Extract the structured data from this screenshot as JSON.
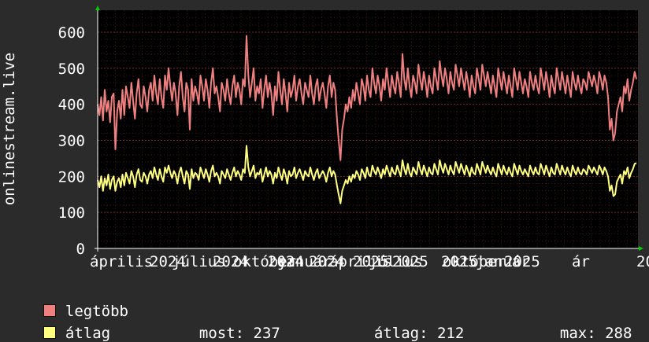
{
  "chart_data": {
    "type": "line",
    "ylabel": "onlinestream.live",
    "yticks": [
      "0",
      "100",
      "200",
      "300",
      "400",
      "500",
      "600"
    ],
    "ylim": [
      0,
      650
    ],
    "xtick_labels": [
      "április",
      "2024",
      "július",
      "2024",
      "október",
      "2024",
      "január",
      "2024",
      "április",
      "2025",
      "július",
      "2025",
      "október",
      "2025",
      "január",
      "2025",
      "ár",
      "20"
    ],
    "grid": true,
    "series": [
      {
        "name": "legtöbb",
        "color": "#f08080",
        "values": [
          400,
          370,
          420,
          355,
          440,
          380,
          410,
          350,
          420,
          430,
          275,
          380,
          410,
          360,
          440,
          370,
          450,
          420,
          390,
          460,
          410,
          360,
          430,
          470,
          400,
          390,
          450,
          420,
          380,
          440,
          460,
          410,
          480,
          430,
          400,
          470,
          420,
          390,
          480,
          440,
          500,
          450,
          410,
          460,
          430,
          370,
          450,
          490,
          420,
          380,
          460,
          440,
          330,
          470,
          410,
          450,
          430,
          400,
          480,
          450,
          410,
          470,
          440,
          390,
          460,
          500,
          430,
          450,
          420,
          380,
          460,
          440,
          410,
          470,
          430,
          400,
          450,
          480,
          420,
          460,
          440,
          400,
          470,
          450,
          590,
          480,
          420,
          460,
          500,
          410,
          450,
          430,
          470,
          390,
          440,
          480,
          420,
          460,
          430,
          370,
          450,
          410,
          490,
          440,
          400,
          470,
          430,
          380,
          460,
          420,
          440,
          480,
          410,
          450,
          470,
          430,
          400,
          460,
          440,
          420,
          480,
          430,
          400,
          450,
          470,
          410,
          440,
          460,
          430,
          390,
          450,
          480,
          420,
          460,
          440,
          360,
          300,
          245,
          330,
          360,
          400,
          380,
          420,
          390,
          440,
          410,
          460,
          430,
          400,
          470,
          450,
          410,
          480,
          440,
          420,
          500,
          460,
          430,
          480,
          450,
          410,
          470,
          440,
          500,
          460,
          420,
          480,
          450,
          430,
          490,
          460,
          420,
          540,
          470,
          440,
          500,
          450,
          420,
          480,
          460,
          430,
          510,
          470,
          440,
          490,
          460,
          420,
          480,
          450,
          430,
          500,
          470,
          440,
          520,
          480,
          450,
          500,
          470,
          430,
          490,
          460,
          440,
          510,
          480,
          450,
          500,
          470,
          440,
          490,
          460,
          420,
          480,
          450,
          430,
          500,
          470,
          440,
          510,
          480,
          450,
          490,
          460,
          430,
          480,
          450,
          420,
          500,
          470,
          440,
          490,
          460,
          430,
          480,
          450,
          420,
          500,
          470,
          440,
          490,
          460,
          430,
          470,
          450,
          420,
          490,
          460,
          440,
          480,
          450,
          430,
          500,
          470,
          440,
          490,
          460,
          420,
          480,
          450,
          430,
          500,
          470,
          440,
          490,
          460,
          430,
          480,
          450,
          420,
          490,
          460,
          440,
          480,
          450,
          430,
          470,
          460,
          440,
          490,
          470,
          450,
          480,
          460,
          430,
          490,
          470,
          440,
          480,
          460,
          420,
          330,
          360,
          300,
          320,
          380,
          400,
          420,
          380,
          450,
          430,
          470,
          410,
          440,
          460,
          490,
          470
        ],
        "legend_text": ""
      },
      {
        "name": "átlag",
        "color": "#ffff80",
        "values": [
          190,
          170,
          200,
          160,
          195,
          175,
          205,
          165,
          190,
          200,
          160,
          185,
          195,
          170,
          205,
          175,
          210,
          195,
          180,
          215,
          200,
          170,
          205,
          220,
          190,
          185,
          210,
          200,
          180,
          205,
          215,
          195,
          225,
          205,
          190,
          220,
          200,
          185,
          225,
          210,
          230,
          210,
          195,
          215,
          205,
          180,
          210,
          225,
          200,
          180,
          215,
          205,
          165,
          220,
          195,
          210,
          205,
          190,
          225,
          210,
          195,
          220,
          205,
          185,
          215,
          230,
          200,
          210,
          200,
          180,
          215,
          205,
          195,
          220,
          205,
          190,
          210,
          225,
          200,
          215,
          205,
          190,
          220,
          210,
          285,
          225,
          200,
          215,
          230,
          195,
          210,
          205,
          220,
          185,
          205,
          225,
          200,
          215,
          205,
          180,
          210,
          195,
          225,
          205,
          190,
          220,
          205,
          180,
          215,
          200,
          205,
          225,
          195,
          210,
          220,
          205,
          190,
          215,
          205,
          200,
          225,
          205,
          190,
          210,
          220,
          195,
          205,
          215,
          205,
          185,
          210,
          225,
          200,
          215,
          205,
          175,
          150,
          125,
          160,
          175,
          190,
          180,
          200,
          185,
          205,
          195,
          215,
          205,
          190,
          220,
          210,
          195,
          225,
          205,
          200,
          230,
          215,
          205,
          225,
          210,
          195,
          220,
          205,
          230,
          215,
          200,
          225,
          210,
          205,
          230,
          215,
          200,
          245,
          220,
          205,
          235,
          210,
          200,
          225,
          215,
          205,
          240,
          220,
          205,
          230,
          215,
          200,
          225,
          210,
          205,
          235,
          220,
          205,
          245,
          225,
          210,
          235,
          220,
          205,
          230,
          215,
          205,
          240,
          225,
          210,
          235,
          220,
          205,
          230,
          215,
          200,
          225,
          210,
          205,
          235,
          220,
          205,
          240,
          225,
          210,
          230,
          215,
          205,
          225,
          210,
          200,
          235,
          220,
          205,
          230,
          215,
          205,
          225,
          210,
          200,
          235,
          220,
          205,
          230,
          215,
          205,
          220,
          210,
          200,
          230,
          215,
          205,
          225,
          210,
          205,
          235,
          220,
          205,
          230,
          215,
          200,
          225,
          210,
          205,
          235,
          220,
          205,
          230,
          215,
          205,
          225,
          210,
          200,
          230,
          215,
          205,
          225,
          210,
          205,
          220,
          215,
          205,
          230,
          220,
          210,
          225,
          215,
          205,
          230,
          220,
          205,
          225,
          215,
          200,
          160,
          175,
          145,
          150,
          185,
          195,
          205,
          180,
          215,
          205,
          225,
          195,
          210,
          220,
          235,
          237
        ],
        "legend_text": ""
      }
    ],
    "stats": {
      "most_label": "most:",
      "most_value": "237",
      "atlag_label": "átlag:",
      "atlag_value": "212",
      "max_label": "max:",
      "max_value": "288"
    }
  },
  "colors": {
    "background": "#2b2b2b",
    "plot_background": "#000000",
    "grid": "#5a1e1e",
    "axis": "#ffffff",
    "arrow": "#00cc00"
  }
}
